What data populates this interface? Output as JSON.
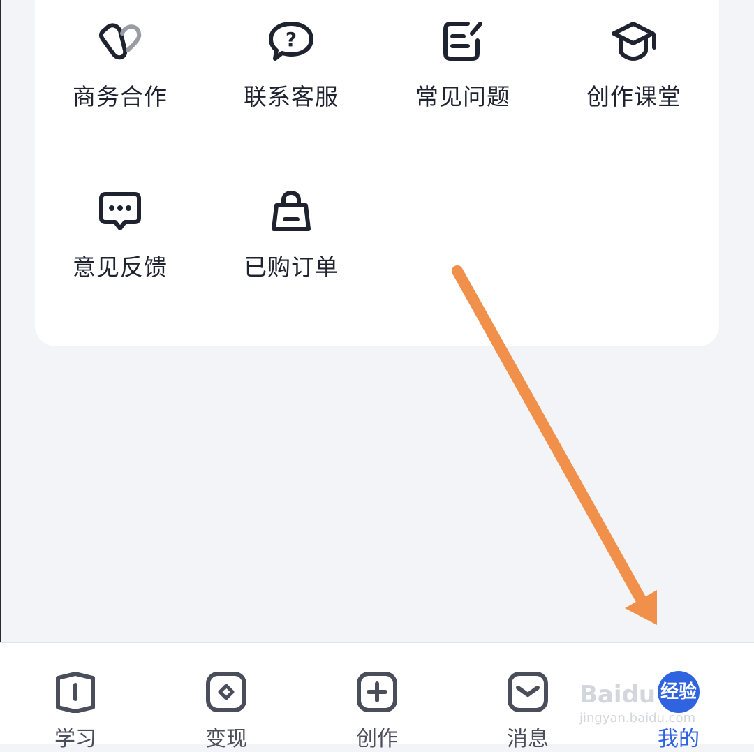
{
  "services": [
    {
      "label": "商务合作",
      "icon": "heart-link-icon"
    },
    {
      "label": "联系客服",
      "icon": "question-bubble-icon"
    },
    {
      "label": "常见问题",
      "icon": "edit-note-icon"
    },
    {
      "label": "创作课堂",
      "icon": "graduation-cap-icon"
    },
    {
      "label": "意见反馈",
      "icon": "chat-dots-icon"
    },
    {
      "label": "已购订单",
      "icon": "shopping-bag-icon"
    }
  ],
  "tabbar": {
    "items": [
      {
        "label": "学习",
        "icon": "book-icon"
      },
      {
        "label": "变现",
        "icon": "coin-icon"
      },
      {
        "label": "创作",
        "icon": "plus-square-icon"
      },
      {
        "label": "消息",
        "icon": "mail-icon"
      },
      {
        "label": "我的",
        "icon": "profile-icon",
        "active": true
      }
    ],
    "profile_badge": "经验"
  },
  "watermark": {
    "text": "Baidu",
    "sub": "jingyan.baidu.com"
  },
  "colors": {
    "accent": "#2f63e0",
    "arrow": "#f0904a",
    "icon": "#1f2330",
    "background": "#f3f4f8"
  }
}
